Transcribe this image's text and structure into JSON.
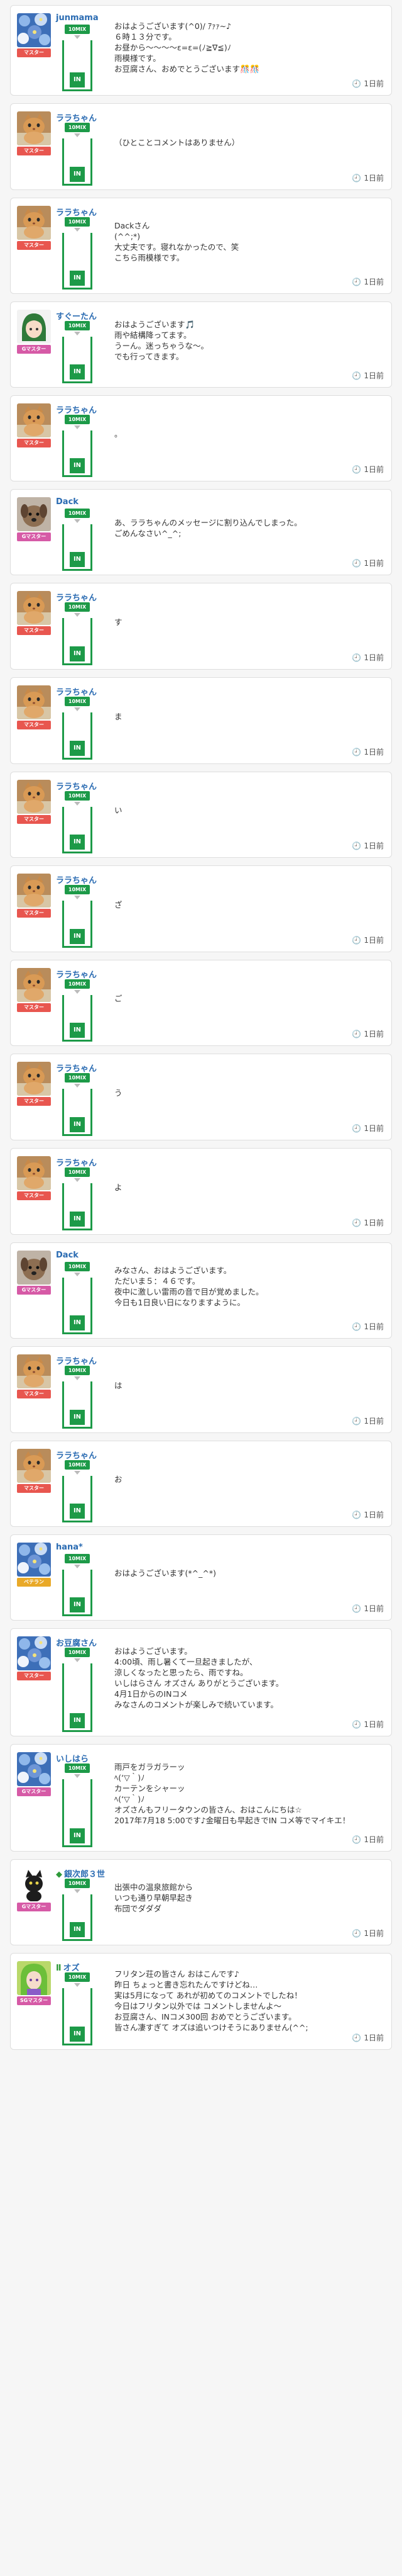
{
  "colors": {
    "master_badge": "#e8564f",
    "gmaster_badge": "#d65aa6",
    "beginner_badge": "#e9a928",
    "tally_green": "#1d9a48",
    "name_blue": "#2a6bb2"
  },
  "posts": [
    {
      "name": "junmama",
      "mark": "",
      "badge": "マスター",
      "badge_type": "master",
      "avatar": "flowers",
      "tag": "10MIX",
      "in_label": "IN",
      "lines": [
        "おはようございます(^0)/ ｱｧｧ~♪",
        "６時１３分です。",
        "お昼から～～～～ε=ε=(ﾉ≧∇≦)ﾉ",
        "雨模様です。",
        "お豆腐さん、おめでとうございます🎊🎊"
      ],
      "time": "1日前"
    },
    {
      "name": "ララちゃん",
      "mark": "",
      "badge": "マスター",
      "badge_type": "master",
      "avatar": "cat",
      "tag": "10MIX",
      "in_label": "IN",
      "lines": [
        "（ひとことコメントはありません）"
      ],
      "time": "1日前"
    },
    {
      "name": "ララちゃん",
      "mark": "",
      "badge": "マスター",
      "badge_type": "master",
      "avatar": "cat",
      "tag": "10MIX",
      "in_label": "IN",
      "lines": [
        "Dackさん",
        "(^^;*)",
        "大丈夫です。寝れなかったので、笑",
        "こちら雨模様です。"
      ],
      "time": "1日前"
    },
    {
      "name": "すぐーたん",
      "mark": "",
      "badge": "Gマスター",
      "badge_type": "gmaster",
      "avatar": "anime",
      "tag": "10MIX",
      "in_label": "IN",
      "lines": [
        "おはようございます🎵",
        "雨や結構降ってます。",
        "うーん。迷っちゃうな～。",
        "でも行ってきます。"
      ],
      "time": "1日前"
    },
    {
      "name": "ララちゃん",
      "mark": "",
      "badge": "マスター",
      "badge_type": "master",
      "avatar": "cat",
      "tag": "10MIX",
      "in_label": "IN",
      "lines": [
        "。"
      ],
      "time": "1日前"
    },
    {
      "name": "Dack",
      "mark": "",
      "badge": "Gマスター",
      "badge_type": "gmaster",
      "avatar": "dog",
      "tag": "10MIX",
      "in_label": "IN",
      "lines": [
        "あ、ララちゃんのメッセージに割り込んでしまった。",
        "ごめんなさい^_^;"
      ],
      "time": "1日前"
    },
    {
      "name": "ララちゃん",
      "mark": "",
      "badge": "マスター",
      "badge_type": "master",
      "avatar": "cat",
      "tag": "10MIX",
      "in_label": "IN",
      "lines": [
        "す"
      ],
      "time": "1日前"
    },
    {
      "name": "ララちゃん",
      "mark": "",
      "badge": "マスター",
      "badge_type": "master",
      "avatar": "cat",
      "tag": "10MIX",
      "in_label": "IN",
      "lines": [
        "ま"
      ],
      "time": "1日前"
    },
    {
      "name": "ララちゃん",
      "mark": "",
      "badge": "マスター",
      "badge_type": "master",
      "avatar": "cat",
      "tag": "10MIX",
      "in_label": "IN",
      "lines": [
        "い"
      ],
      "time": "1日前"
    },
    {
      "name": "ララちゃん",
      "mark": "",
      "badge": "マスター",
      "badge_type": "master",
      "avatar": "cat",
      "tag": "10MIX",
      "in_label": "IN",
      "lines": [
        "ざ"
      ],
      "time": "1日前"
    },
    {
      "name": "ララちゃん",
      "mark": "",
      "badge": "マスター",
      "badge_type": "master",
      "avatar": "cat",
      "tag": "10MIX",
      "in_label": "IN",
      "lines": [
        "ご"
      ],
      "time": "1日前"
    },
    {
      "name": "ララちゃん",
      "mark": "",
      "badge": "マスター",
      "badge_type": "master",
      "avatar": "cat",
      "tag": "10MIX",
      "in_label": "IN",
      "lines": [
        "う"
      ],
      "time": "1日前"
    },
    {
      "name": "ララちゃん",
      "mark": "",
      "badge": "マスター",
      "badge_type": "master",
      "avatar": "cat",
      "tag": "10MIX",
      "in_label": "IN",
      "lines": [
        "よ"
      ],
      "time": "1日前"
    },
    {
      "name": "Dack",
      "mark": "",
      "badge": "Gマスター",
      "badge_type": "gmaster",
      "avatar": "dog",
      "tag": "10MIX",
      "in_label": "IN",
      "lines": [
        "みなさん、おはようございます。",
        "ただいま５：４６です。",
        "夜中に激しい雷雨の音で目が覚めました。",
        "今日も1日良い日になりますように。"
      ],
      "time": "1日前"
    },
    {
      "name": "ララちゃん",
      "mark": "",
      "badge": "マスター",
      "badge_type": "master",
      "avatar": "cat",
      "tag": "10MIX",
      "in_label": "IN",
      "lines": [
        "は"
      ],
      "time": "1日前"
    },
    {
      "name": "ララちゃん",
      "mark": "",
      "badge": "マスター",
      "badge_type": "master",
      "avatar": "cat",
      "tag": "10MIX",
      "in_label": "IN",
      "lines": [
        "お"
      ],
      "time": "1日前"
    },
    {
      "name": "hana*",
      "mark": "",
      "badge": "ベテラン",
      "badge_type": "beginner",
      "avatar": "flowers",
      "tag": "10MIX",
      "in_label": "IN",
      "lines": [
        "おはようございます(*^_^*)"
      ],
      "time": "1日前"
    },
    {
      "name": "お豆腐さん",
      "mark": "",
      "badge": "マスター",
      "badge_type": "master",
      "avatar": "flowers",
      "tag": "10MIX",
      "in_label": "IN",
      "lines": [
        "おはようございます。",
        "4:00頃、雨し暑くて一旦起きましたが、",
        "涼しくなったと思ったら、雨ですね。",
        "いしはらさん オズさん ありがとうございます。",
        "4月1日からのINコメ",
        "みなさんのコメントが楽しみで続いています。"
      ],
      "time": "1日前"
    },
    {
      "name": "いしはら",
      "mark": "",
      "badge": "Gマスター",
      "badge_type": "gmaster",
      "avatar": "flowers",
      "tag": "10MIX",
      "in_label": "IN",
      "lines": [
        "雨戸をガラガラーッ",
        "ﾍ(‘▽｀)ﾉ",
        "カーテンをシャーッ",
        "ﾍ(‘▽｀)ﾉ",
        "オズさんもフリータウンの皆さん、おはこんにちは☆",
        "2017年7月18 5:00です♪金曜日も早起きでIN コメ等でマイキエ！"
      ],
      "time": "1日前"
    },
    {
      "name": "銀次郎３世",
      "mark": "◆",
      "badge": "Gマスター",
      "badge_type": "gmaster",
      "avatar": "blackcat",
      "tag": "10MIX",
      "in_label": "IN",
      "lines": [
        "出張中の温泉旅館から",
        "いつも通り早朝早起き",
        "布団でダダダ"
      ],
      "time": "1日前"
    },
    {
      "name": "オズ",
      "mark": "Ⅱ",
      "badge": "SGマスター",
      "badge_type": "gmaster",
      "avatar": "greenhair",
      "tag": "10MIX",
      "in_label": "IN",
      "lines": [
        "フリタン荘の皆さん おはこんです♪",
        "昨日 ちょっと書き忘れたんですけどね…",
        "実は5月になって あれが初めてのコメントでしたね！",
        "今日はフリタン以外では コメントしませんよ～",
        "お豆腐さん、INコメ300回 おめでとうございます。",
        "皆さん凄すぎて オズは追いつけそうにありません(^^;"
      ],
      "time": "1日前"
    }
  ]
}
